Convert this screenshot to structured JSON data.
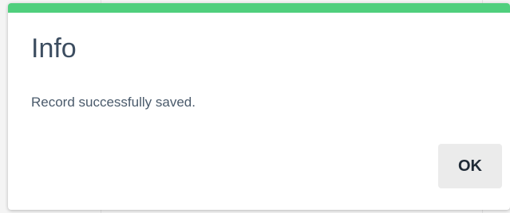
{
  "dialog": {
    "title": "Info",
    "message": "Record successfully saved.",
    "ok_label": "OK",
    "accent_color": "#4fcf7d"
  }
}
